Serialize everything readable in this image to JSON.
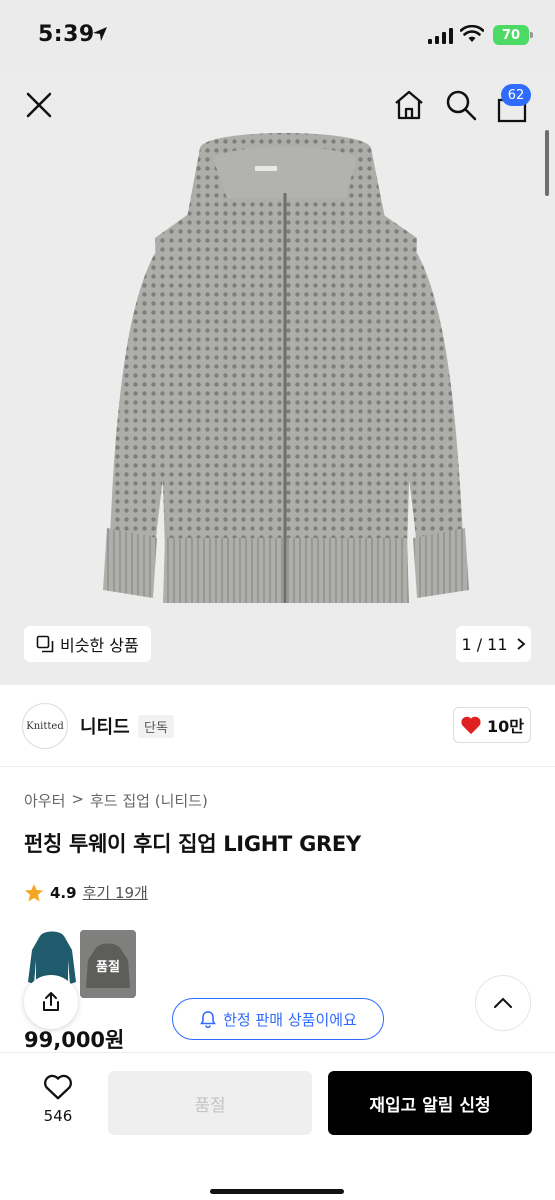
{
  "status_bar": {
    "time": "5:39",
    "battery": "70"
  },
  "nav": {
    "cart_count": "62"
  },
  "hero": {
    "similar_label": "비슷한 상품",
    "counter": "1 / 11"
  },
  "brand": {
    "logo_text": "Knitted",
    "name": "니티드",
    "tag": "단독",
    "likes": "10만"
  },
  "breadcrumb": [
    "아우터",
    ">",
    "후드 집업 (니티드)"
  ],
  "product": {
    "title": "펀칭 투웨이 후디 집업 LIGHT GREY",
    "rating": "4.9",
    "reviews": "후기 19개",
    "price": "99,000원"
  },
  "swatches": {
    "soldout_label": "품절"
  },
  "limited_notice": "한정 판매 상품이에요",
  "bottom": {
    "wish_count": "546",
    "soldout_label": "품절",
    "restock_label": "재입고 알림 신청"
  },
  "colors": {
    "accent": "#2f6bff",
    "heart": "#e02020",
    "star": "#f5a623",
    "product": "#a8a8a4"
  }
}
